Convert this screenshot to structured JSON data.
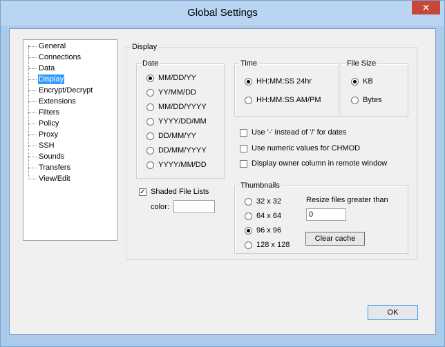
{
  "window": {
    "title": "Global Settings",
    "close_glyph": "✕"
  },
  "tree": {
    "items": [
      "General",
      "Connections",
      "Data",
      "Display",
      "Encrypt/Decrypt",
      "Extensions",
      "Filters",
      "Policy",
      "Proxy",
      "SSH",
      "Sounds",
      "Transfers",
      "View/Edit"
    ],
    "selected": "Display"
  },
  "display_group": {
    "title": "Display"
  },
  "date_group": {
    "title": "Date",
    "options": [
      "MM/DD/YY",
      "YY/MM/DD",
      "MM/DD/YYYY",
      "YYYY/DD/MM",
      "DD/MM/YY",
      "DD/MM/YYYY",
      "YYYY/MM/DD"
    ],
    "selected": "MM/DD/YY"
  },
  "time_group": {
    "title": "Time",
    "options": [
      "HH:MM:SS 24hr",
      "HH:MM:SS AM/PM"
    ],
    "selected": "HH:MM:SS 24hr"
  },
  "filesize_group": {
    "title": "File Size",
    "options": [
      "KB",
      "Bytes"
    ],
    "selected": "KB"
  },
  "checkboxes": {
    "dash_dates": {
      "label": "Use '-' instead of '/' for dates",
      "checked": false
    },
    "numeric_chmod": {
      "label": "Use numeric values for CHMOD",
      "checked": false
    },
    "owner_column": {
      "label": "Display owner column in remote window",
      "checked": false
    }
  },
  "shaded": {
    "label": "Shaded File Lists",
    "checked": true,
    "color_label": "color:",
    "color_value": ""
  },
  "thumbnails_group": {
    "title": "Thumbnails",
    "options": [
      "32 x 32",
      "64 x 64",
      "96 x 96",
      "128 x 128"
    ],
    "selected": "96 x 96",
    "resize_label": "Resize files greater than",
    "resize_value": "0",
    "clear_cache_label": "Clear cache"
  },
  "ok_label": "OK"
}
